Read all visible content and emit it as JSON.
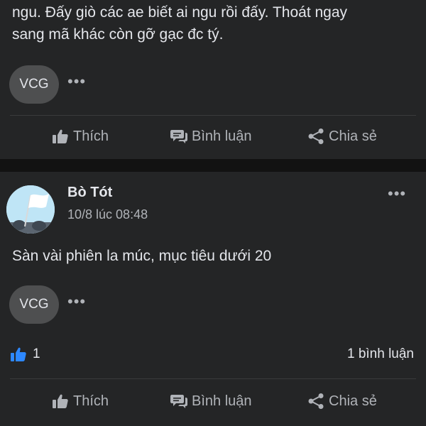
{
  "post_1": {
    "text": "ngu. Đấy giò các ae biết ai ngu rồi đấy. Thoát ngay\nsang mã khác còn gỡ gạc đc tý.",
    "reactor_chip": "VCG",
    "more_glyph": "•••"
  },
  "post_2": {
    "author": "Bò Tót",
    "timestamp": "10/8 lúc 08:48",
    "menu_glyph": "•••",
    "text": "Sàn vài phiên la múc, mục tiêu dưới 20",
    "reactor_chip": "VCG",
    "more_glyph": "•••",
    "like_count": "1",
    "comment_count": "1 bình luận"
  },
  "actions": {
    "like": "Thích",
    "comment": "Bình luận",
    "share": "Chia sẻ"
  },
  "icons": {
    "like": "thumbs-up-icon",
    "comment": "comment-bubble-icon",
    "share": "share-icon",
    "like_reaction": "like-reaction-icon",
    "avatar": "white-flag-avatar",
    "more": "more-options-icon"
  },
  "colors": {
    "card": "#242526",
    "separator": "#121212",
    "text_primary": "#e4e6eb",
    "text_secondary": "#b0b3b8",
    "chip": "#4e4f50",
    "like_blue": "#2d88ff",
    "avatar_sky": "#bfe5f6"
  }
}
